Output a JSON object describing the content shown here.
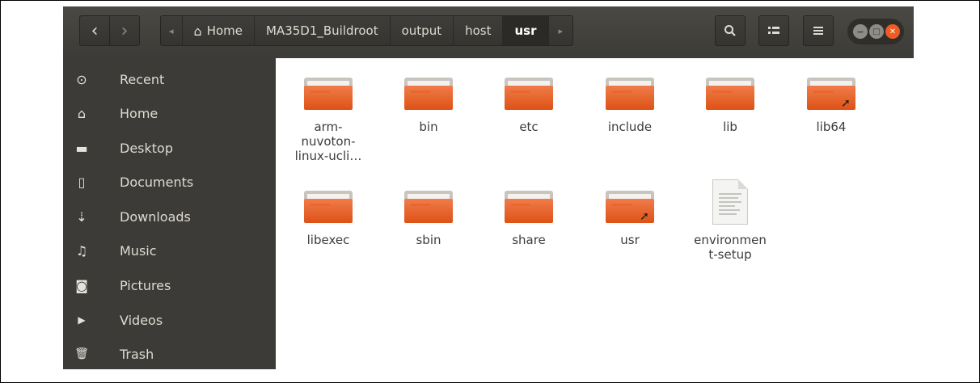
{
  "toolbar": {
    "back_glyph": "‹",
    "forward_glyph": "›",
    "left_arrow": "◂",
    "right_arrow": "▸",
    "home_glyph": "⌂",
    "search_glyph": "🔍",
    "view_glyph": "☷",
    "menu_glyph": "☰",
    "minimize_glyph": "−",
    "maximize_glyph": "□",
    "close_glyph": "✕"
  },
  "breadcrumb": [
    "Home",
    "MA35D1_Buildroot",
    "output",
    "host",
    "usr"
  ],
  "sidebar": {
    "items": [
      {
        "label": "Recent",
        "icon": "⊙",
        "icon_name": "recent-icon"
      },
      {
        "label": "Home",
        "icon": "⌂",
        "icon_name": "home-icon"
      },
      {
        "label": "Desktop",
        "icon": "▬",
        "icon_name": "desktop-icon"
      },
      {
        "label": "Documents",
        "icon": "▯",
        "icon_name": "documents-icon"
      },
      {
        "label": "Downloads",
        "icon": "⇣",
        "icon_name": "downloads-icon"
      },
      {
        "label": "Music",
        "icon": "♫",
        "icon_name": "music-icon"
      },
      {
        "label": "Pictures",
        "icon": "◙",
        "icon_name": "pictures-icon"
      },
      {
        "label": "Videos",
        "icon": "▶",
        "icon_name": "videos-icon"
      },
      {
        "label": "Trash",
        "icon": "🗑",
        "icon_name": "trash-icon"
      }
    ]
  },
  "files": [
    {
      "name": "arm-\nnuvoton-\nlinux-ucli…",
      "type": "folder",
      "link": false
    },
    {
      "name": "bin",
      "type": "folder",
      "link": false
    },
    {
      "name": "etc",
      "type": "folder",
      "link": false
    },
    {
      "name": "include",
      "type": "folder",
      "link": false
    },
    {
      "name": "lib",
      "type": "folder",
      "link": false
    },
    {
      "name": "lib64",
      "type": "folder",
      "link": true
    },
    {
      "name": "libexec",
      "type": "folder",
      "link": false
    },
    {
      "name": "sbin",
      "type": "folder",
      "link": false
    },
    {
      "name": "share",
      "type": "folder",
      "link": false
    },
    {
      "name": "usr",
      "type": "folder",
      "link": true
    },
    {
      "name": "environmen\nt-setup",
      "type": "document",
      "link": false
    }
  ],
  "colors": {
    "folder_orange": "#e8692b",
    "sidebar_bg": "#3c3b37",
    "close_button": "#f05a23"
  }
}
